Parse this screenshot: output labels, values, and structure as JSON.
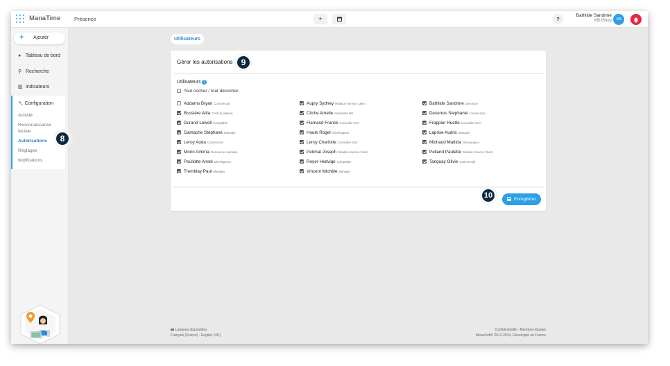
{
  "header": {
    "brand": "ManaTime",
    "module": "Présence",
    "add_glyph": "+",
    "help_glyph": "?",
    "user_name": "Bathilde Sandrine",
    "company": "KB iShop",
    "avatar_initials": "SB"
  },
  "sidebar": {
    "add_label": "Ajouter",
    "items": [
      {
        "label": "Tableau de bord",
        "icon": "pie-chart-icon",
        "glyph": "◕"
      },
      {
        "label": "Recherche",
        "icon": "search-icon",
        "glyph": "⚲"
      },
      {
        "label": "Indicateurs",
        "icon": "bar-chart-icon",
        "glyph": "▥"
      }
    ],
    "config": {
      "title": "Configuration",
      "glyph": "🔧",
      "sub_items": [
        "Activité",
        "Reconnaissance faciale",
        "Autorisations",
        "Réglages",
        "Notifications"
      ],
      "active": "Autorisations"
    }
  },
  "main": {
    "tab_label": "Utilisateurs",
    "panel_title": "Gérer les autorisations",
    "users_label": "Utilisateurs",
    "help_glyph": "?",
    "toggle_all": "Tout cocher / tout décocher",
    "users": [
      {
        "name": "Addams Bryan",
        "role": "Commercial",
        "checked": false
      },
      {
        "name": "Aupry Sydney",
        "role": "Relation Service Client",
        "checked": true
      },
      {
        "name": "Bathilde Sandrine",
        "role": "Directrice",
        "checked": true
      },
      {
        "name": "Bussière Alita",
        "role": "Chef de plateau",
        "checked": true
      },
      {
        "name": "Cliche Amelie",
        "role": "Assistante RH",
        "checked": true
      },
      {
        "name": "Deserres Stephanie",
        "role": "Commercial",
        "checked": true
      },
      {
        "name": "Durand Lowell",
        "role": "Comptable",
        "checked": true
      },
      {
        "name": "Flamand Franck",
        "role": "Conseiller SAV",
        "checked": true
      },
      {
        "name": "Frappier Huette",
        "role": "Conseiller SAV",
        "checked": true
      },
      {
        "name": "Gamache Stéphane",
        "role": "Manager",
        "checked": true
      },
      {
        "name": "Houle Roger",
        "role": "Développeur",
        "checked": true
      },
      {
        "name": "Laprise Audric",
        "role": "Manager",
        "checked": true
      },
      {
        "name": "Leroy Auda",
        "role": "Commercial",
        "checked": true
      },
      {
        "name": "Leroy Charlotte",
        "role": "Conseiller SAV",
        "checked": true
      },
      {
        "name": "Michaud Matilda",
        "role": "Développeur",
        "checked": true
      },
      {
        "name": "Morin Aimma",
        "role": "Ressource Humaine",
        "checked": true
      },
      {
        "name": "Pelchat Joseph",
        "role": "Relation Service Client",
        "checked": true
      },
      {
        "name": "Pelland Paulette",
        "role": "Relation Service Client",
        "checked": true
      },
      {
        "name": "Pouliotte Ansel",
        "role": "Développeur",
        "checked": true
      },
      {
        "name": "Royer Hedvige",
        "role": "Comptable",
        "checked": true
      },
      {
        "name": "Tanguay Olivie",
        "role": "Commercial",
        "checked": true
      },
      {
        "name": "Tremblay Paul",
        "role": "Manager",
        "checked": true
      },
      {
        "name": "Vincent Michèle",
        "role": "Manager",
        "checked": true
      }
    ],
    "save_label": "Enregistrer"
  },
  "badges": [
    "8",
    "9",
    "10"
  ],
  "footer": {
    "languages_title": "Langues disponibles",
    "languages": "Français (France) - English (UK)",
    "links": "Confidentialité - Mentions légales",
    "copyright": "ManaSoft© 2012-2024, Développé en France"
  },
  "colors": {
    "accent": "#2d9ee8",
    "notification": "#e8253f",
    "badge": "#0b2a3d"
  }
}
